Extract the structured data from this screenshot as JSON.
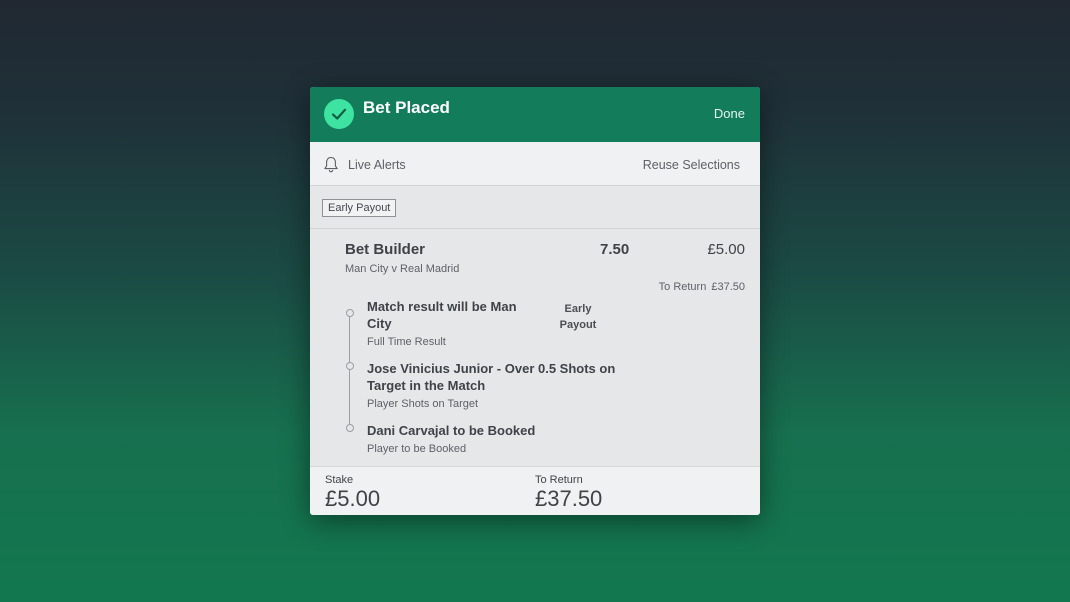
{
  "header": {
    "title": "Bet Placed",
    "done_label": "Done",
    "icon": "check-icon"
  },
  "alerts": {
    "live_alerts_label": "Live Alerts",
    "reuse_label": "Reuse Selections",
    "icon": "bell-icon"
  },
  "tag": {
    "label": "Early Payout"
  },
  "bet": {
    "name": "Bet Builder",
    "odds": "7.50",
    "stake": "£5.00",
    "event": "Man City v Real Madrid",
    "to_return_label": "To Return",
    "to_return_value": "£37.50",
    "early_payout_label_1": "Early",
    "early_payout_label_2": "Payout",
    "legs": [
      {
        "title_line1": "Match result will be Man",
        "title_line2": "City",
        "market": "Full Time Result"
      },
      {
        "title_line1": "Jose Vinicius Junior - Over 0.5 Shots on",
        "title_line2": "Target in the Match",
        "market": "Player Shots on Target"
      },
      {
        "title_line1": "Dani Carvajal to be Booked",
        "market": "Player to be Booked"
      }
    ]
  },
  "footer": {
    "stake_label": "Stake",
    "stake_value": "£5.00",
    "return_label": "To Return",
    "return_value": "£37.50"
  }
}
